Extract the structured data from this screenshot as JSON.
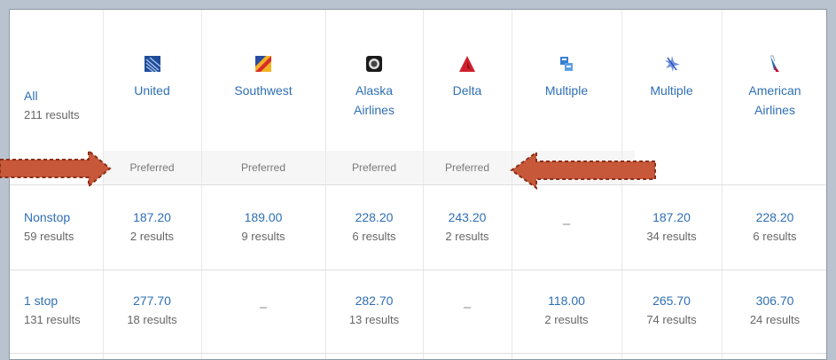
{
  "all": {
    "label": "All",
    "count": "211 results"
  },
  "airlines": [
    {
      "name": "United",
      "icon": "united-logo-icon",
      "preferred": "Preferred"
    },
    {
      "name": "Southwest",
      "icon": "southwest-logo-icon",
      "preferred": "Preferred"
    },
    {
      "name": "Alaska Airlines",
      "icon": "alaska-logo-icon",
      "preferred": "Preferred"
    },
    {
      "name": "Delta",
      "icon": "delta-logo-icon",
      "preferred": "Preferred"
    },
    {
      "name": "Multiple",
      "icon": "multiple-logo-icon",
      "preferred": ""
    },
    {
      "name": "Multiple",
      "icon": "multiple-plane-icon",
      "preferred": ""
    },
    {
      "name": "American Airlines",
      "icon": "american-logo-icon",
      "preferred": ""
    }
  ],
  "rows": [
    {
      "label": "Nonstop",
      "count": "59 results",
      "cells": [
        {
          "price": "187.20",
          "results": "2 results"
        },
        {
          "price": "189.00",
          "results": "9 results"
        },
        {
          "price": "228.20",
          "results": "6 results"
        },
        {
          "price": "243.20",
          "results": "2 results"
        },
        {
          "price": "–",
          "results": ""
        },
        {
          "price": "187.20",
          "results": "34 results"
        },
        {
          "price": "228.20",
          "results": "6 results"
        }
      ]
    },
    {
      "label": "1 stop",
      "count": "131 results",
      "cells": [
        {
          "price": "277.70",
          "results": "18 results"
        },
        {
          "price": "–",
          "results": ""
        },
        {
          "price": "282.70",
          "results": "13 results"
        },
        {
          "price": "–",
          "results": ""
        },
        {
          "price": "118.00",
          "results": "2 results"
        },
        {
          "price": "265.70",
          "results": "74 results"
        },
        {
          "price": "306.70",
          "results": "24 results"
        }
      ]
    }
  ],
  "colors": {
    "link": "#2f6fb4",
    "arrow": "#c8583a",
    "arrow_outline": "#8a2e1a"
  }
}
